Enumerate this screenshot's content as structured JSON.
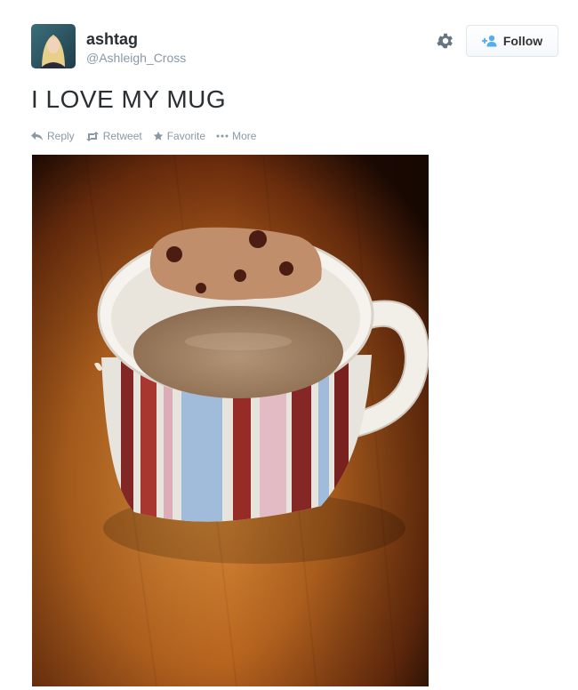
{
  "tweet": {
    "user": {
      "display_name": "ashtag",
      "username": "@Ashleigh_Cross",
      "avatar_icon": "profile-photo"
    },
    "text": "I LOVE MY MUG",
    "follow_label": "Follow",
    "actions": [
      {
        "label": "Reply",
        "icon": "reply-icon"
      },
      {
        "label": "Retweet",
        "icon": "retweet-icon"
      },
      {
        "label": "Favorite",
        "icon": "star-icon"
      },
      {
        "label": "More",
        "icon": "more-dots-icon"
      }
    ],
    "media": {
      "description_icon": "mug-photo"
    },
    "colors": {
      "accent": "#55acee",
      "muted": "#8899a6",
      "text": "#292f33"
    }
  }
}
